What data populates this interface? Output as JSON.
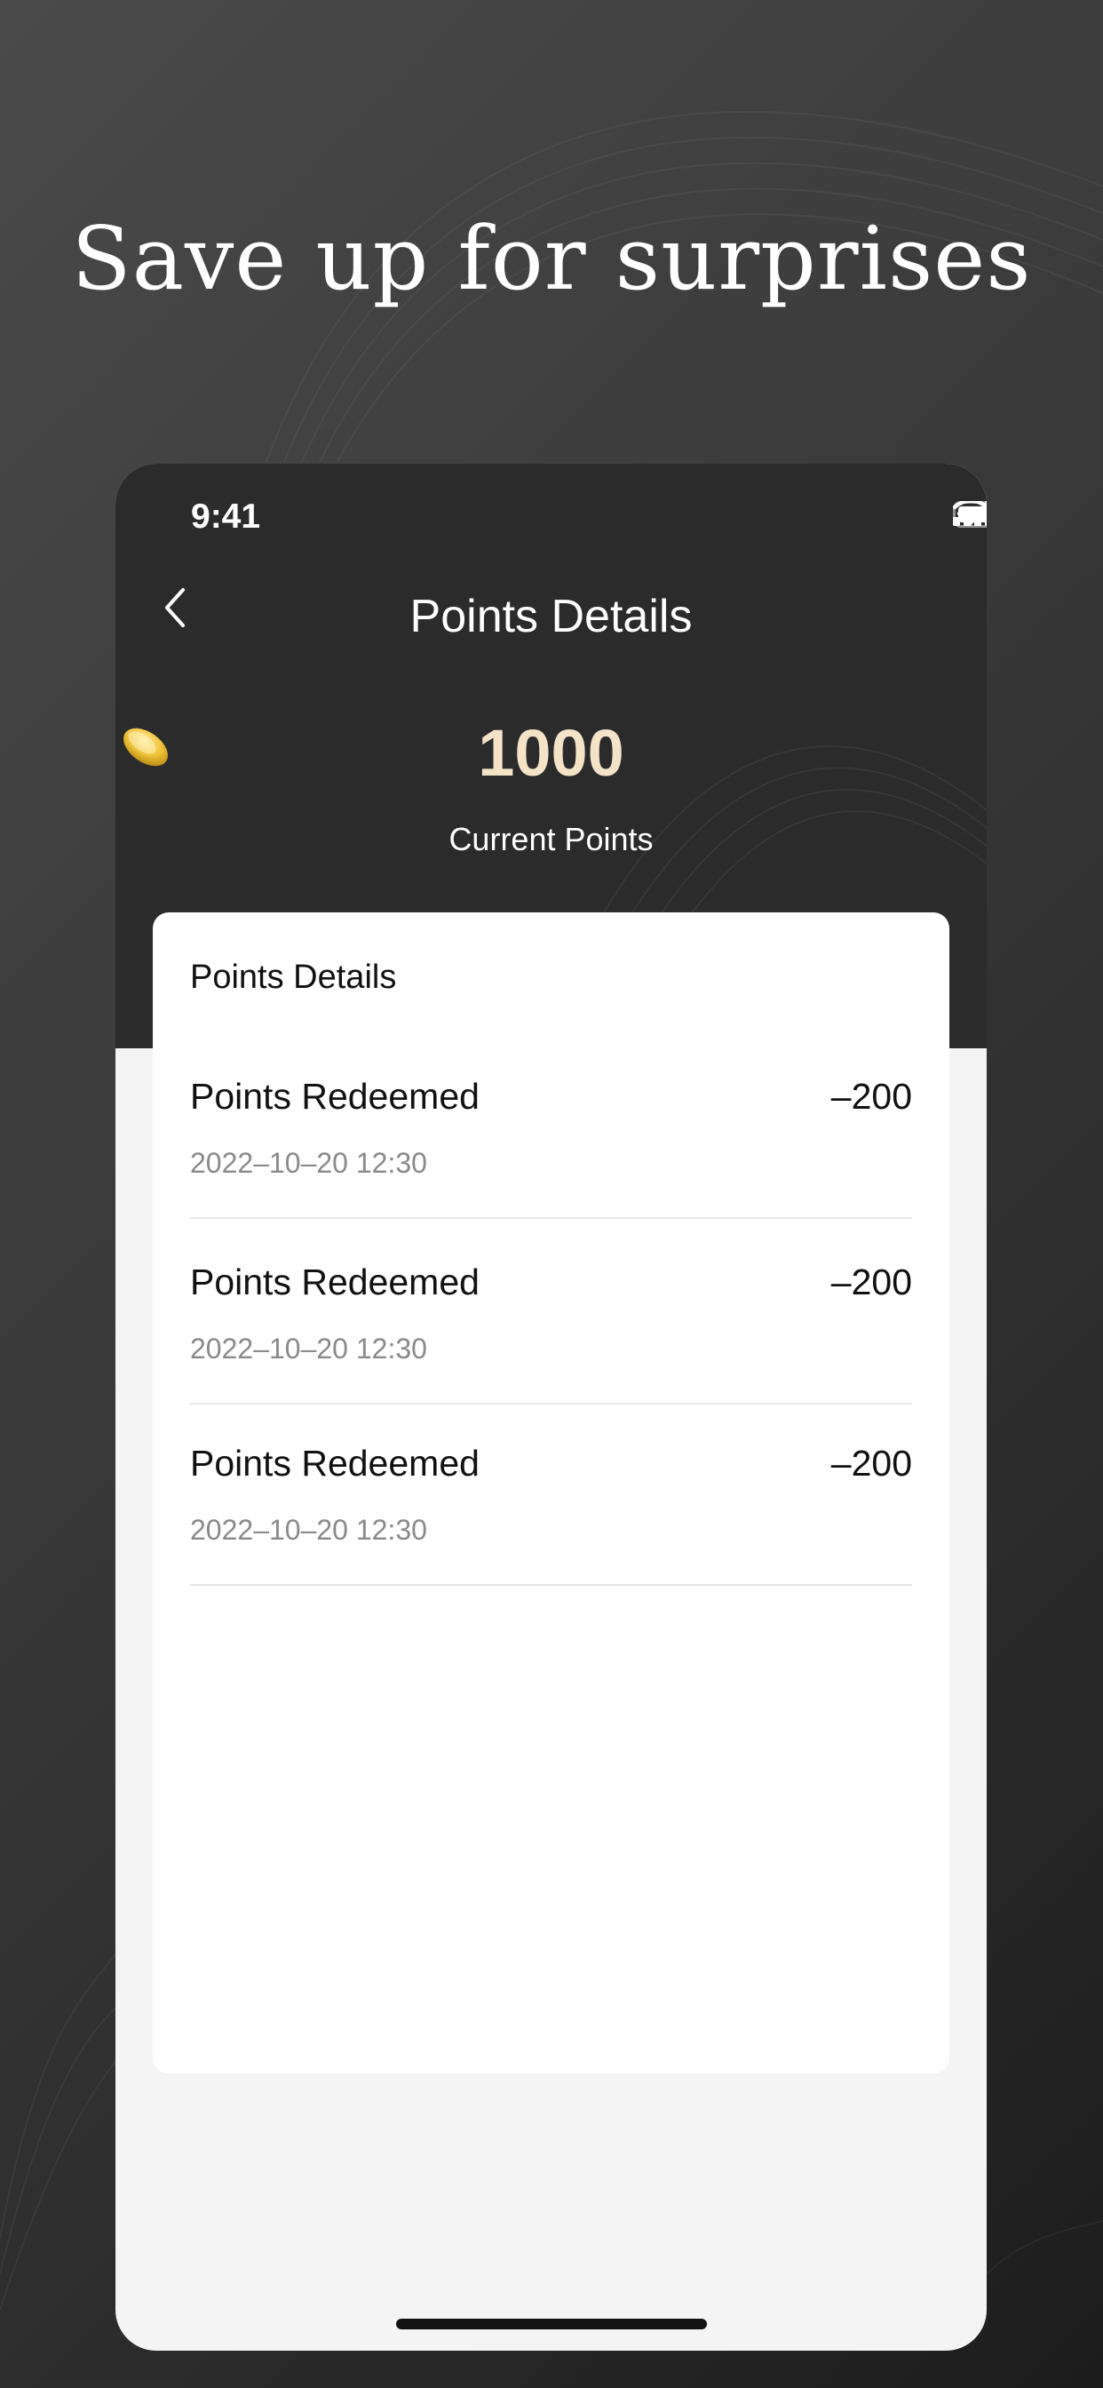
{
  "headline": "Save up for surprises",
  "status_bar": {
    "time": "9:41",
    "icons": [
      "signal-icon",
      "wifi-icon",
      "battery-icon"
    ]
  },
  "nav": {
    "back_icon": "chevron-left-icon",
    "title": "Points Details"
  },
  "points": {
    "icon": "coin-icon",
    "value": "1000",
    "label": "Current Points"
  },
  "details_card": {
    "title": "Points Details",
    "records": [
      {
        "name": "Points Redeemed",
        "amount": "–200",
        "time": "2022–10–20 12:30"
      },
      {
        "name": "Points Redeemed",
        "amount": "–200",
        "time": "2022–10–20 12:30"
      },
      {
        "name": "Points Redeemed",
        "amount": "–200",
        "time": "2022–10–20 12:30"
      }
    ]
  },
  "colors": {
    "background_dark": "#2b2b2b",
    "points_gold": "#f5e3c8",
    "coin": "#f0c43a",
    "divider": "#e6e6e6",
    "muted_text": "#8a8a8a"
  }
}
